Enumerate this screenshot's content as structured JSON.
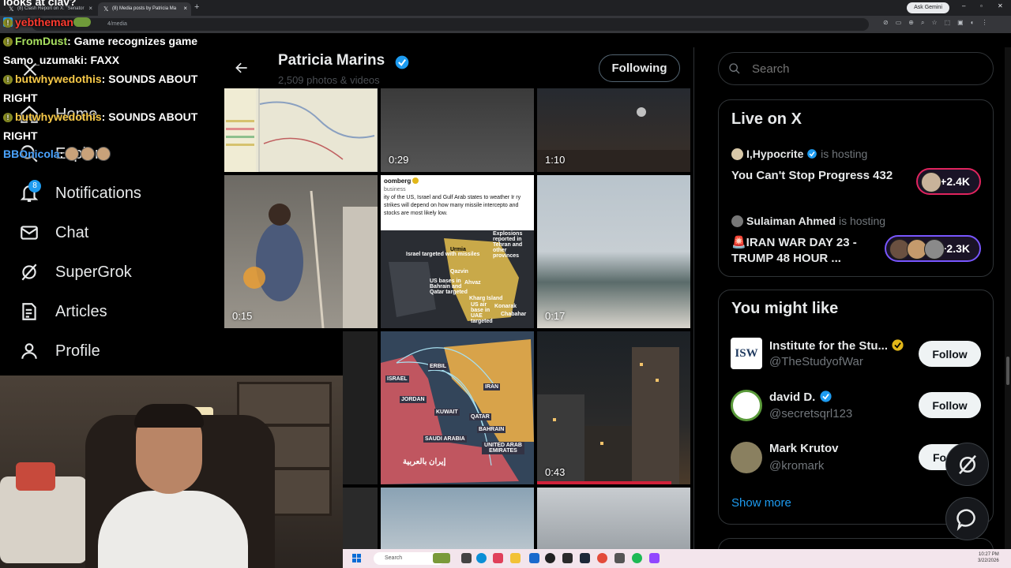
{
  "browser": {
    "tabs": [
      {
        "label": "(8) Clash Report on X: \"Senator"
      },
      {
        "label": "(8) Media posts by Patricia Ma"
      }
    ],
    "url_fragment": "4/media",
    "gemini_label": "Ask Gemini"
  },
  "chat": {
    "top_clip": "looks at clav?",
    "messages": [
      {
        "user": "yebtheman",
        "text": ""
      },
      {
        "user": "FromDust",
        "text": " Game recognizes game"
      },
      {
        "user": "Samo_uzumaki",
        "text": " FAXX"
      },
      {
        "user": "butwhywedothis",
        "text": " SOUNDS ABOUT"
      },
      {
        "cont": "RIGHT"
      },
      {
        "user": "butwhywedothis",
        "text": " SOUNDS ABOUT"
      },
      {
        "cont": "RIGHT"
      },
      {
        "user": "BBOnicola",
        "text": ""
      }
    ]
  },
  "nav": {
    "items": [
      {
        "label": "Home",
        "icon": "home-icon"
      },
      {
        "label": "Explore",
        "icon": "search-icon"
      },
      {
        "label": "Notifications",
        "icon": "bell-icon",
        "badge": "8"
      },
      {
        "label": "Chat",
        "icon": "mail-icon"
      },
      {
        "label": "SuperGrok",
        "icon": "grok-icon"
      },
      {
        "label": "Articles",
        "icon": "article-icon"
      },
      {
        "label": "Profile",
        "icon": "person-icon"
      }
    ]
  },
  "profile": {
    "name": "Patricia Marins",
    "subtitle": "2,509 photos & videos",
    "following_label": "Following"
  },
  "media": {
    "durations": [
      "0:29",
      "1:10",
      "0:15",
      "0:17",
      "0:43"
    ],
    "tweet_snippet": {
      "source": "oomberg",
      "sub": "business",
      "text": "ity of the US, Israel and Gulf Arab states to weather Ir ry strikes will depend on how many missile intercepto and stocks are most likely low."
    },
    "map1_labels": [
      "Israel targeted with missiles",
      "Urmia",
      "Qazvin",
      "Ahvaz",
      "Kharg Island",
      "Chabahar",
      "Konarak",
      "US bases in Bahrain and Qatar targeted",
      "US air base in UAE targeted",
      "Explosions reported in Tehran and other provinces"
    ],
    "map2_labels": [
      "ERBIL",
      "ISRAEL",
      "JORDAN",
      "KUWAIT",
      "QATAR",
      "IRAN",
      "BAHRAIN",
      "SAUDI ARABIA",
      "UNITED ARAB EMIRATES"
    ],
    "map2_footer": "إيران بالعربية"
  },
  "search": {
    "placeholder": "Search"
  },
  "live": {
    "title": "Live on X",
    "spaces": [
      {
        "host": "I,Hypocrite",
        "hosting": "is hosting",
        "title": "You Can't Stop Progress 432",
        "count": "+2.4K"
      },
      {
        "host": "Sulaiman Ahmed",
        "hosting": "is hosting",
        "title_line1": "🚨IRAN WAR DAY 23 -",
        "title_line2": "TRUMP 48 HOUR ...",
        "count": "+2.3K"
      }
    ]
  },
  "wtf": {
    "title": "You might like",
    "accounts": [
      {
        "name": "Institute for the Stu...",
        "handle": "@TheStudyofWar",
        "avatar_text": "ISW",
        "button": "Follow"
      },
      {
        "name": "david D.",
        "handle": "@secretsqrl123",
        "button": "Follow"
      },
      {
        "name": "Mark Krutov",
        "handle": "@kromark",
        "button": "Fo"
      }
    ],
    "show_more": "Show more"
  },
  "taskbar": {
    "search_label": "Search",
    "time": "10:27 PM",
    "date": "3/22/2026"
  },
  "colors": {
    "accent": "#1d9bf0",
    "gold_verified": "#e2b719",
    "taskbar": "#f3e5ec"
  }
}
